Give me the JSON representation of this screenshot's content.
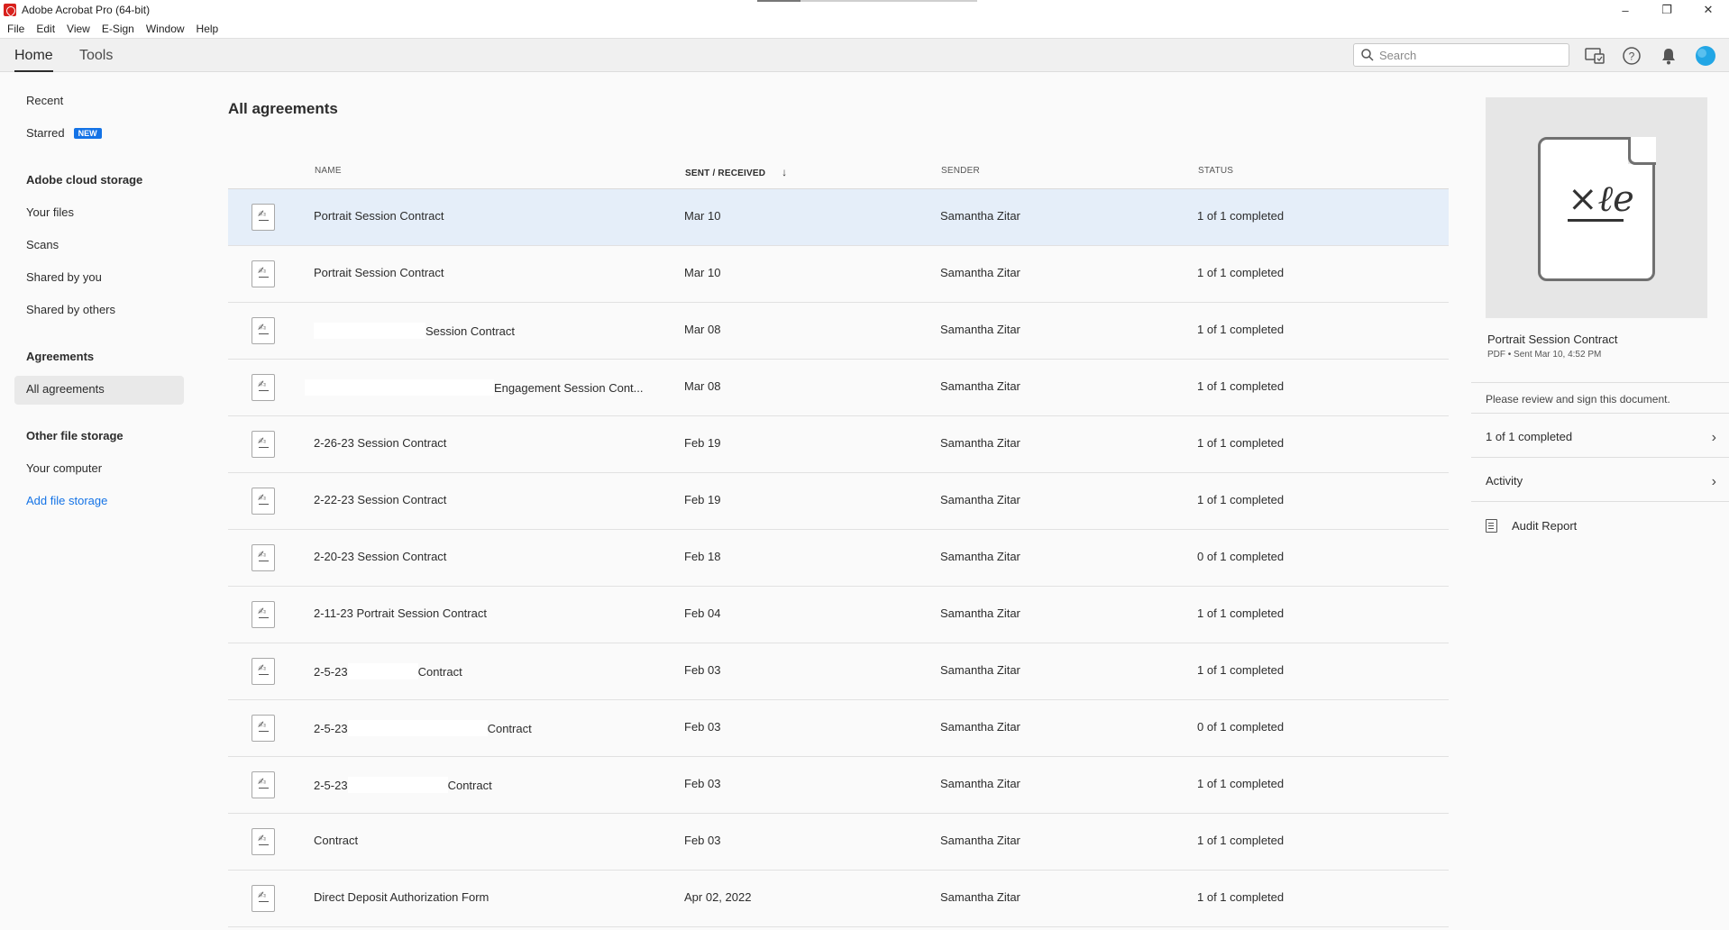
{
  "window": {
    "title": "Adobe Acrobat Pro (64-bit)",
    "minimize": "–",
    "maximize": "❐",
    "close": "✕"
  },
  "menu": [
    "File",
    "Edit",
    "View",
    "E-Sign",
    "Window",
    "Help"
  ],
  "tabs": {
    "home": "Home",
    "tools": "Tools"
  },
  "search": {
    "placeholder": "Search"
  },
  "nav": {
    "recent": "Recent",
    "starred": "Starred",
    "starred_badge": "NEW",
    "cloud_head": "Adobe cloud storage",
    "your_files": "Your files",
    "scans": "Scans",
    "shared_by_you": "Shared by you",
    "shared_by_others": "Shared by others",
    "agreements_head": "Agreements",
    "all_agreements": "All agreements",
    "other_head": "Other file storage",
    "your_computer": "Your computer",
    "add_storage": "Add file storage"
  },
  "main": {
    "title": "All agreements",
    "columns": {
      "name": "NAME",
      "sent": "SENT / RECEIVED",
      "sender": "SENDER",
      "status": "STATUS"
    },
    "rows": [
      {
        "name": "Portrait Session Contract",
        "date": "Mar 10",
        "sender": "Samantha Zitar",
        "status": "1 of 1 completed"
      },
      {
        "name": "Portrait Session Contract",
        "date": "Mar 10",
        "sender": "Samantha Zitar",
        "status": "1 of 1 completed"
      },
      {
        "name": "Session Contract",
        "date": "Mar 08",
        "sender": "Samantha Zitar",
        "status": "1 of 1 completed"
      },
      {
        "name": "Engagement Session Cont...",
        "date": "Mar 08",
        "sender": "Samantha Zitar",
        "status": "1 of 1 completed"
      },
      {
        "name": "2-26-23 Session Contract",
        "date": "Feb 19",
        "sender": "Samantha Zitar",
        "status": "1 of 1 completed"
      },
      {
        "name": "2-22-23 Session Contract",
        "date": "Feb 19",
        "sender": "Samantha Zitar",
        "status": "1 of 1 completed"
      },
      {
        "name": "2-20-23 Session Contract",
        "date": "Feb 18",
        "sender": "Samantha Zitar",
        "status": "0 of 1 completed"
      },
      {
        "name": "2-11-23 Portrait Session Contract",
        "date": "Feb 04",
        "sender": "Samantha Zitar",
        "status": "1 of 1 completed"
      },
      {
        "name_prefix": "2-5-23",
        "name": "Contract",
        "date": "Feb 03",
        "sender": "Samantha Zitar",
        "status": "1 of 1 completed"
      },
      {
        "name_prefix": "2-5-23",
        "name": "Contract",
        "date": "Feb 03",
        "sender": "Samantha Zitar",
        "status": "0 of 1 completed"
      },
      {
        "name_prefix": "2-5-23",
        "name": "Contract",
        "date": "Feb 03",
        "sender": "Samantha Zitar",
        "status": "1 of 1 completed"
      },
      {
        "name": "Contract",
        "date": "Feb 03",
        "sender": "Samantha Zitar",
        "status": "1 of 1 completed"
      },
      {
        "name": "Direct Deposit Authorization Form",
        "date": "Apr 02, 2022",
        "sender": "Samantha Zitar",
        "status": "1 of 1 completed"
      }
    ]
  },
  "panel": {
    "title": "Portrait Session Contract",
    "meta": "PDF  •  Sent Mar 10, 4:52 PM",
    "message": "Please review and sign this document.",
    "completed": "1 of 1 completed",
    "activity": "Activity",
    "audit": "Audit Report",
    "sig_glyph": "×ℓe"
  }
}
